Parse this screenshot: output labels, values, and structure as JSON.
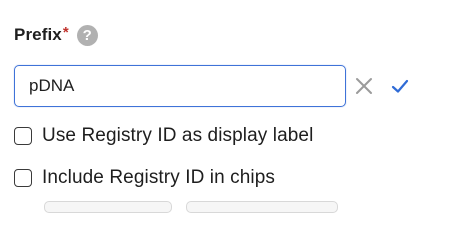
{
  "field": {
    "label": "Prefix",
    "required_marker": "*",
    "help_icon_glyph": "?",
    "input_value": "pDNA"
  },
  "actions": {
    "cancel_icon": "close-icon",
    "confirm_icon": "check-icon"
  },
  "options": [
    {
      "label": "Use Registry ID as display label",
      "checked": false
    },
    {
      "label": "Include Registry ID in chips",
      "checked": false
    }
  ],
  "colors": {
    "focus_border": "#3f73d8",
    "required": "#c0312b",
    "help_icon_bg": "#b1b1b1",
    "confirm": "#2f6bd6",
    "cancel": "#9b9b9b"
  }
}
